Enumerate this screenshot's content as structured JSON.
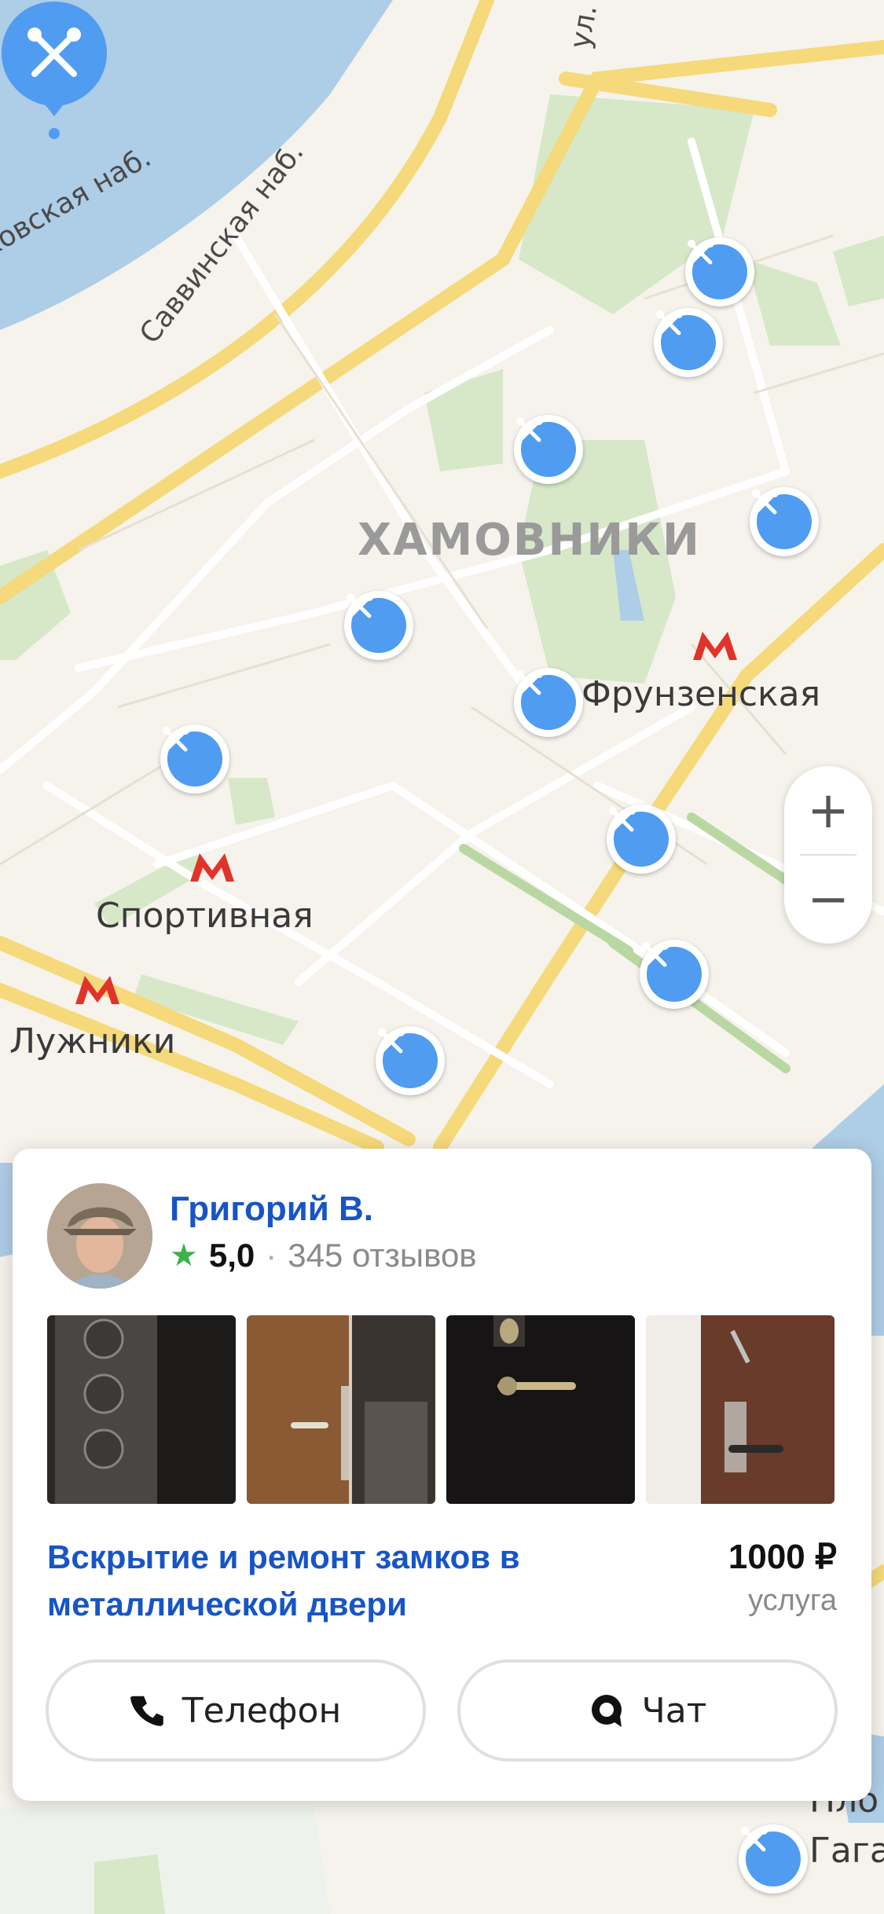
{
  "map": {
    "district_label": "ХАМОВНИКИ",
    "street_labels": [
      "ковская наб.",
      "Саввинская наб.",
      "ул."
    ],
    "metro_stations": [
      "Фрунзенская",
      "Спортивная",
      "Лужники"
    ],
    "partial_labels": [
      "Пло",
      "Гага"
    ],
    "pin_icon": "tools-icon",
    "metro_icon": "metro-m-icon",
    "zoom": {
      "plus": "+",
      "minus": "−"
    }
  },
  "card": {
    "name": "Григорий В.",
    "rating": "5,0",
    "separator": "·",
    "reviews": "345 отзывов",
    "service_title": "Вскрытие и ремонт замков в металлической двери",
    "price": "1000 ₽",
    "price_unit": "услуга",
    "phone_label": "Телефон",
    "chat_label": "Чат",
    "colors": {
      "link": "#1855c4",
      "star": "#3db24a",
      "pin": "#4f9cf0"
    }
  }
}
